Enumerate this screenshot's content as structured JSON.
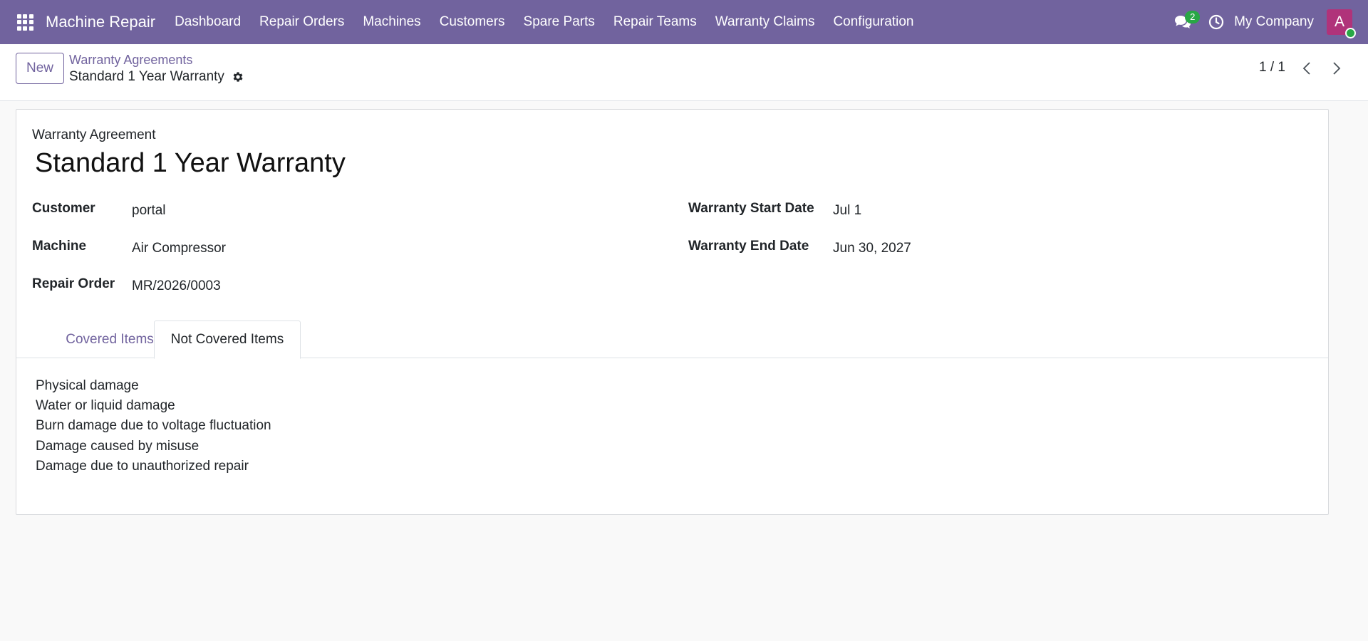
{
  "app": {
    "name": "Machine Repair",
    "menu": [
      "Dashboard",
      "Repair Orders",
      "Machines",
      "Customers",
      "Spare Parts",
      "Repair Teams",
      "Warranty Claims",
      "Configuration"
    ],
    "chat_badge": "2",
    "company": "My Company",
    "avatar_letter": "A",
    "colors": {
      "brand": "#71639e",
      "badge": "#28a745",
      "avatar": "#b0337a"
    }
  },
  "control_panel": {
    "new_label": "New",
    "breadcrumb_parent": "Warranty Agreements",
    "breadcrumb_current": "Standard 1 Year Warranty",
    "pager": "1 / 1"
  },
  "form": {
    "model_label": "Warranty Agreement",
    "name": "Standard 1 Year Warranty",
    "fields_left": [
      {
        "label": "Customer",
        "value": "portal"
      },
      {
        "label": "Machine",
        "value": "Air Compressor"
      },
      {
        "label": "Repair Order",
        "value": "MR/2026/0003"
      }
    ],
    "fields_right": [
      {
        "label": "Warranty Start Date",
        "value": "Jul 1"
      },
      {
        "label": "Warranty End Date",
        "value": "Jun 30, 2027"
      }
    ],
    "tabs": [
      {
        "label": "Covered Items",
        "active": false
      },
      {
        "label": "Not Covered Items",
        "active": true
      }
    ],
    "not_covered_items": [
      "Physical damage",
      "Water or liquid damage",
      "Burn damage due to voltage fluctuation",
      "Damage caused by misuse",
      "Damage due to unauthorized repair"
    ]
  }
}
